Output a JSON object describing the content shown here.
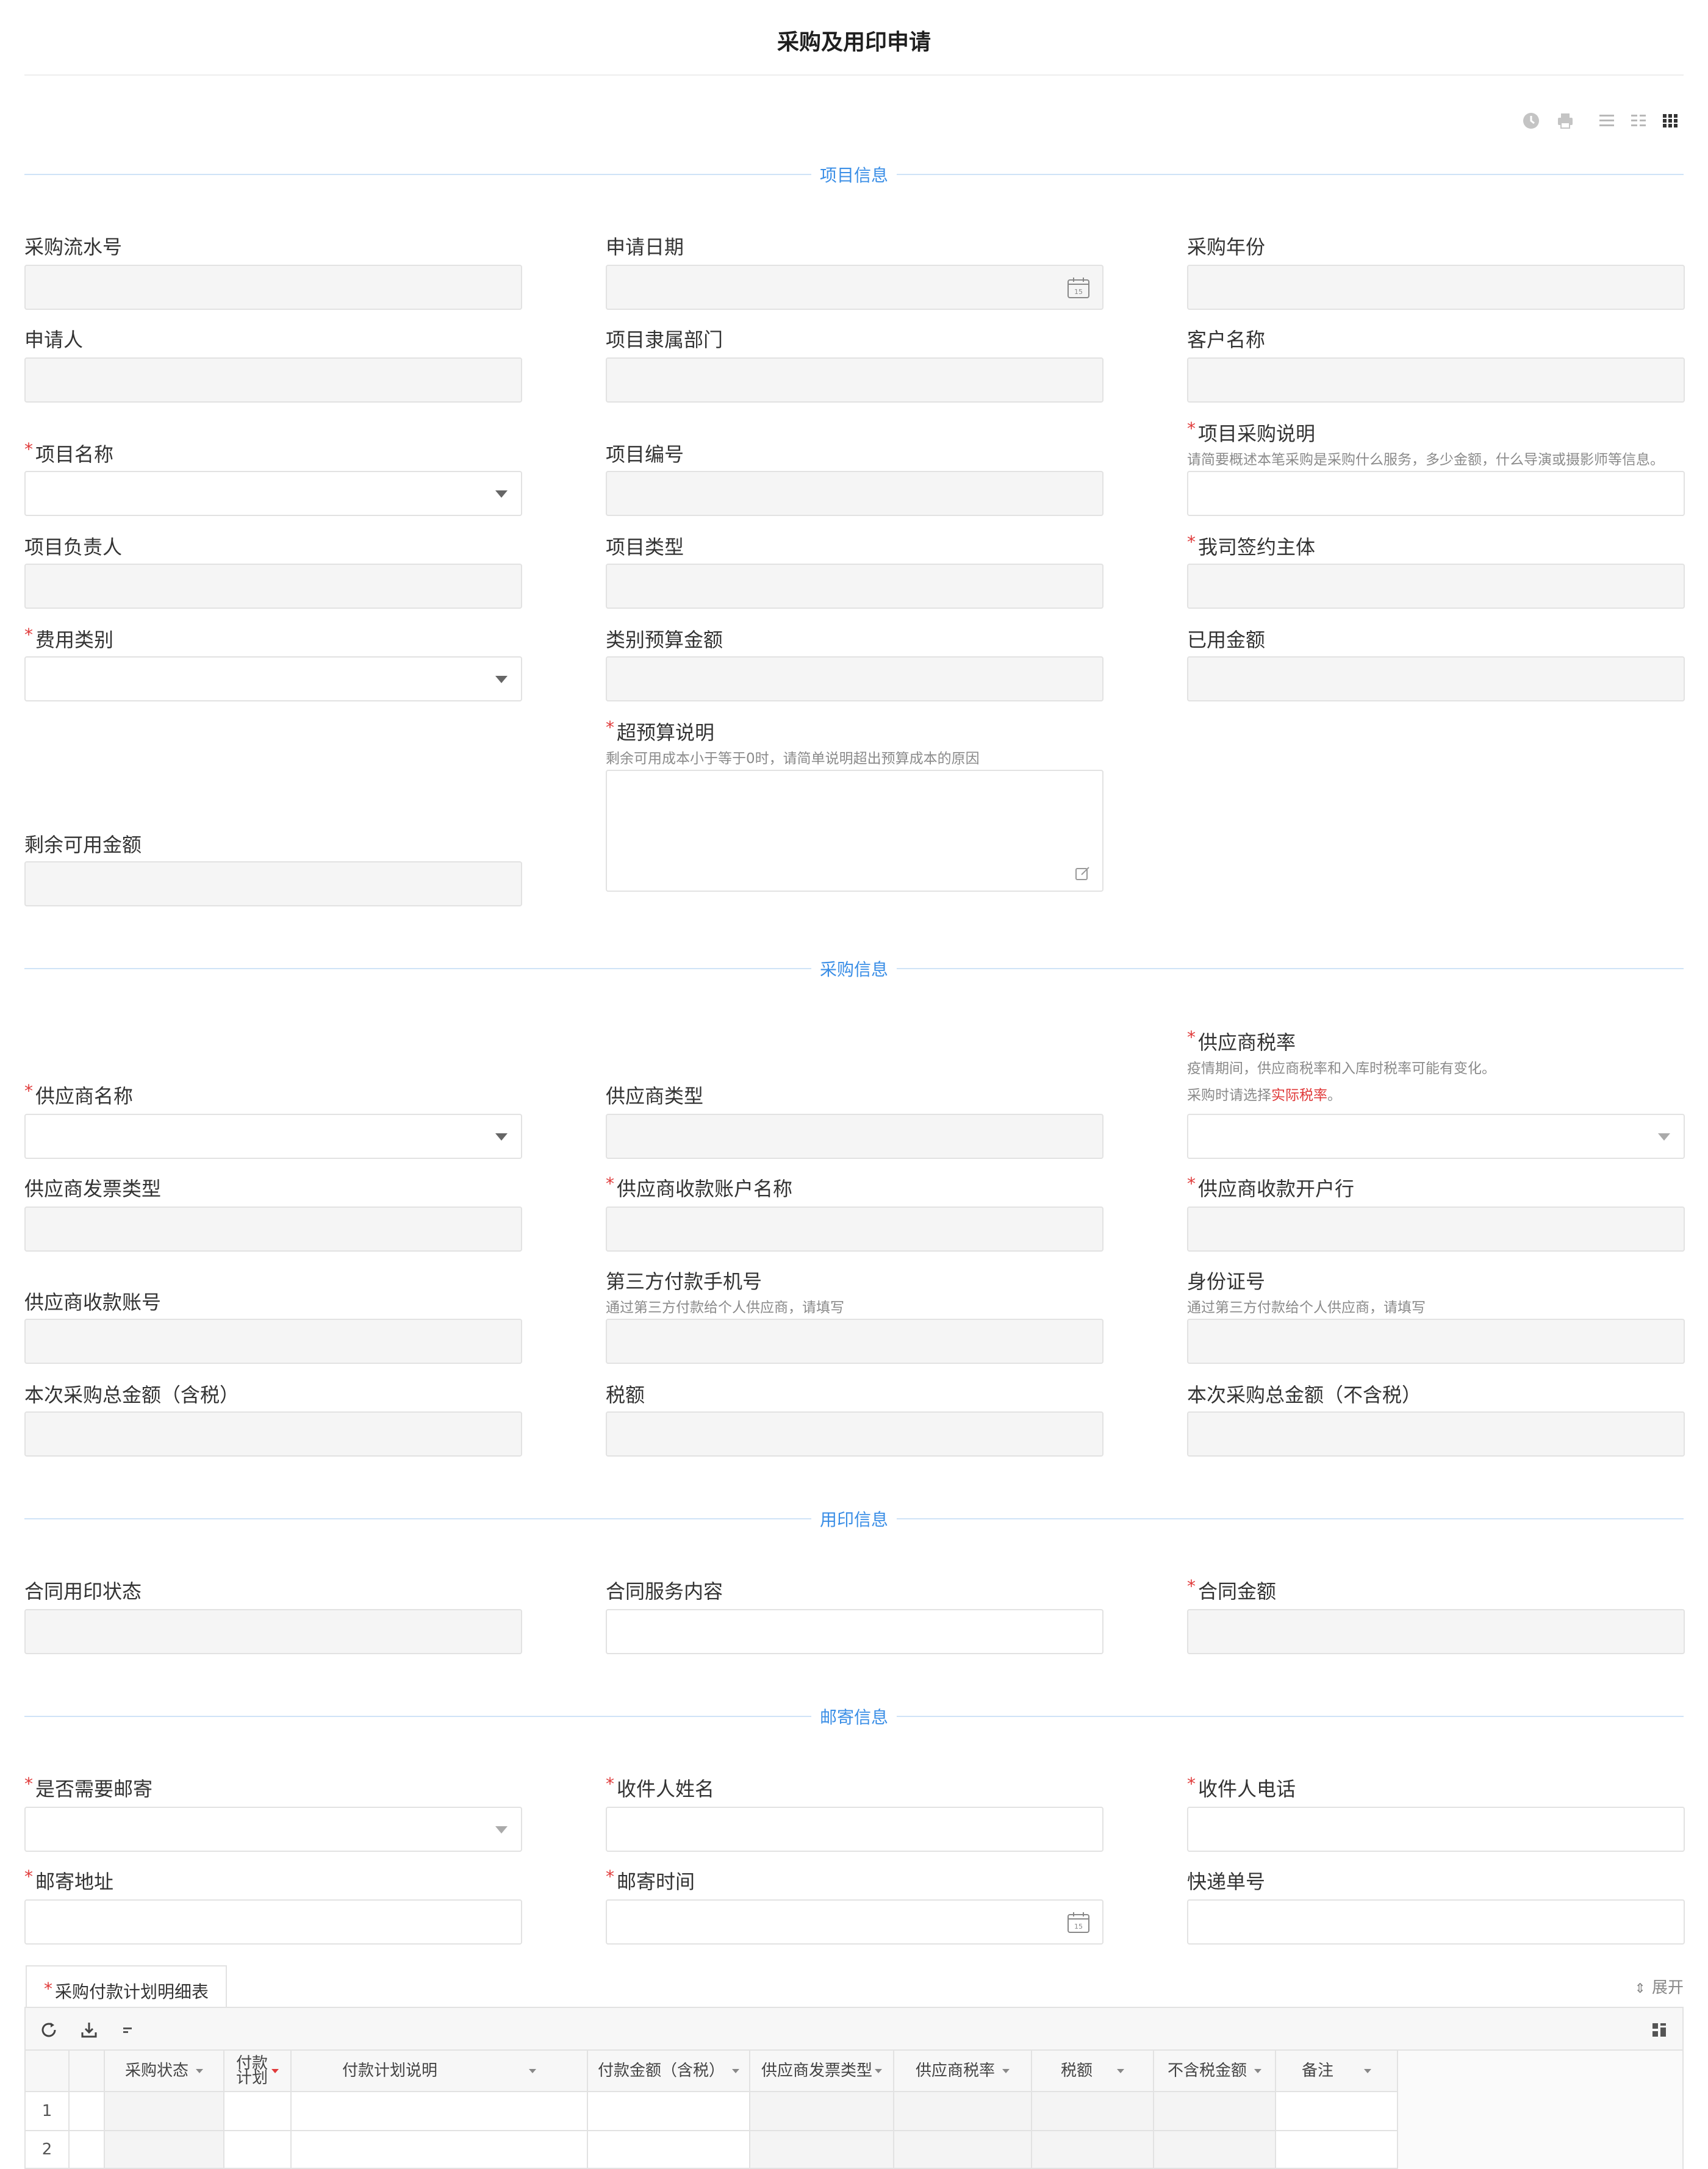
{
  "title": "采购及用印申请",
  "toolbar": {
    "icons": [
      "history-icon",
      "print-icon",
      "list-view-icon",
      "two-column-icon",
      "three-column-icon"
    ]
  },
  "colors": {
    "accent": "#3a8ee6",
    "required": "#e03a3a",
    "readonly_bg": "#f5f5f5"
  },
  "sections": {
    "project": "项目信息",
    "purchase": "采购信息",
    "seal": "用印信息",
    "mail": "邮寄信息"
  },
  "project": {
    "serial_no": "采购流水号",
    "apply_date": "申请日期",
    "purchase_year": "采购年份",
    "applicant": "申请人",
    "project_dept": "项目隶属部门",
    "customer_name": "客户名称",
    "project_name": "项目名称",
    "project_code": "项目编号",
    "purchase_desc": "项目采购说明",
    "purchase_desc_hint": "请简要概述本笔采购是采购什么服务，多少金额，什么导演或摄影师等信息。",
    "project_owner": "项目负责人",
    "project_type": "项目类型",
    "signing_entity": "我司签约主体",
    "expense_category": "费用类别",
    "category_budget": "类别预算金额",
    "used_amount": "已用金额",
    "over_budget": "超预算说明",
    "over_budget_hint": "剩余可用成本小于等于0时，请简单说明超出预算成本的原因",
    "remaining_amount": "剩余可用金额"
  },
  "purchase": {
    "supplier_tax_rate": "供应商税率",
    "supplier_tax_hint1": "疫情期间，供应商税率和入库时税率可能有变化。",
    "supplier_tax_hint2_a": "采购时请选择",
    "supplier_tax_hint2_red": "实际税率",
    "supplier_tax_hint2_b": "。",
    "supplier_name": "供应商名称",
    "supplier_type": "供应商类型",
    "invoice_type": "供应商发票类型",
    "account_name": "供应商收款账户名称",
    "bank": "供应商收款开户行",
    "account_no": "供应商收款账号",
    "third_phone": "第三方付款手机号",
    "third_phone_hint": "通过第三方付款给个人供应商，请填写",
    "id_no": "身份证号",
    "id_no_hint": "通过第三方付款给个人供应商，请填写",
    "total_tax_incl": "本次采购总金额（含税）",
    "tax": "税额",
    "total_tax_excl": "本次采购总金额（不含税）"
  },
  "seal": {
    "status": "合同用印状态",
    "service": "合同服务内容",
    "amount": "合同金额"
  },
  "mail": {
    "need_mail": "是否需要邮寄",
    "recipient": "收件人姓名",
    "phone": "收件人电话",
    "address": "邮寄地址",
    "time": "邮寄时间",
    "tracking": "快递单号"
  },
  "detail": {
    "tab": "采购付款计划明细表",
    "expand": "展开",
    "columns": [
      "采购状态",
      "付款计划",
      "付款计划说明",
      "付款金额（含税）",
      "供应商发票类型",
      "供应商税率",
      "税额",
      "不含税金额",
      "备注"
    ],
    "column_short_2": [
      "付款",
      "计划"
    ],
    "rows": [
      "1",
      "2"
    ]
  }
}
